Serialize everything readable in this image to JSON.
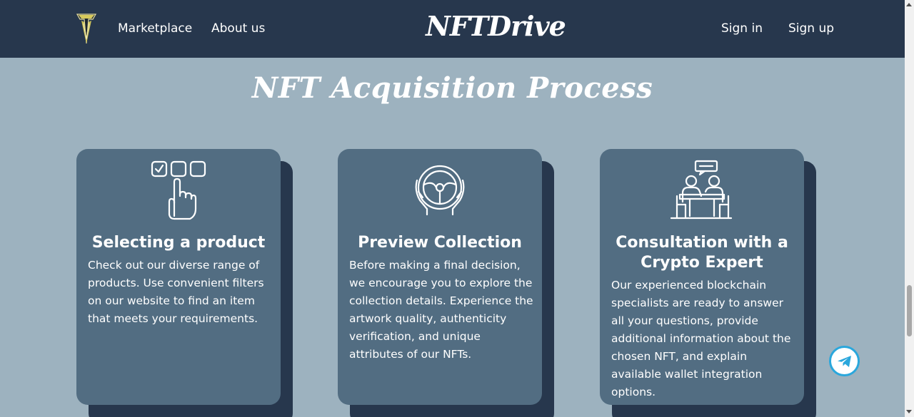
{
  "nav": {
    "links": [
      "Marketplace",
      "About us"
    ],
    "brand": "NFTDrive",
    "auth": [
      "Sign in",
      "Sign up"
    ]
  },
  "heading": "NFT Acquisition Process",
  "cards": [
    {
      "icon": "checkbox-hand-icon",
      "title": "Selecting a product",
      "text": "Check out our diverse range of products. Use convenient filters on our website to find an item that meets your requirements."
    },
    {
      "icon": "steering-wheel-icon",
      "title": "Preview Collection",
      "text": "Before making a final decision, we encourage you to explore the collection details. Experience the artwork quality, authenticity verification, and unique attributes of our NFTs."
    },
    {
      "icon": "consultation-icon",
      "title": "Consultation with a Crypto Expert",
      "text": "Our experienced blockchain specialists are ready to answer all your questions, provide additional information about the chosen NFT, and explain available wallet integration options."
    }
  ],
  "colors": {
    "nav_bg": "#27374d",
    "page_bg": "#9db2bf",
    "card_bg": "#526d82",
    "telegram": "#2aa7dc"
  }
}
